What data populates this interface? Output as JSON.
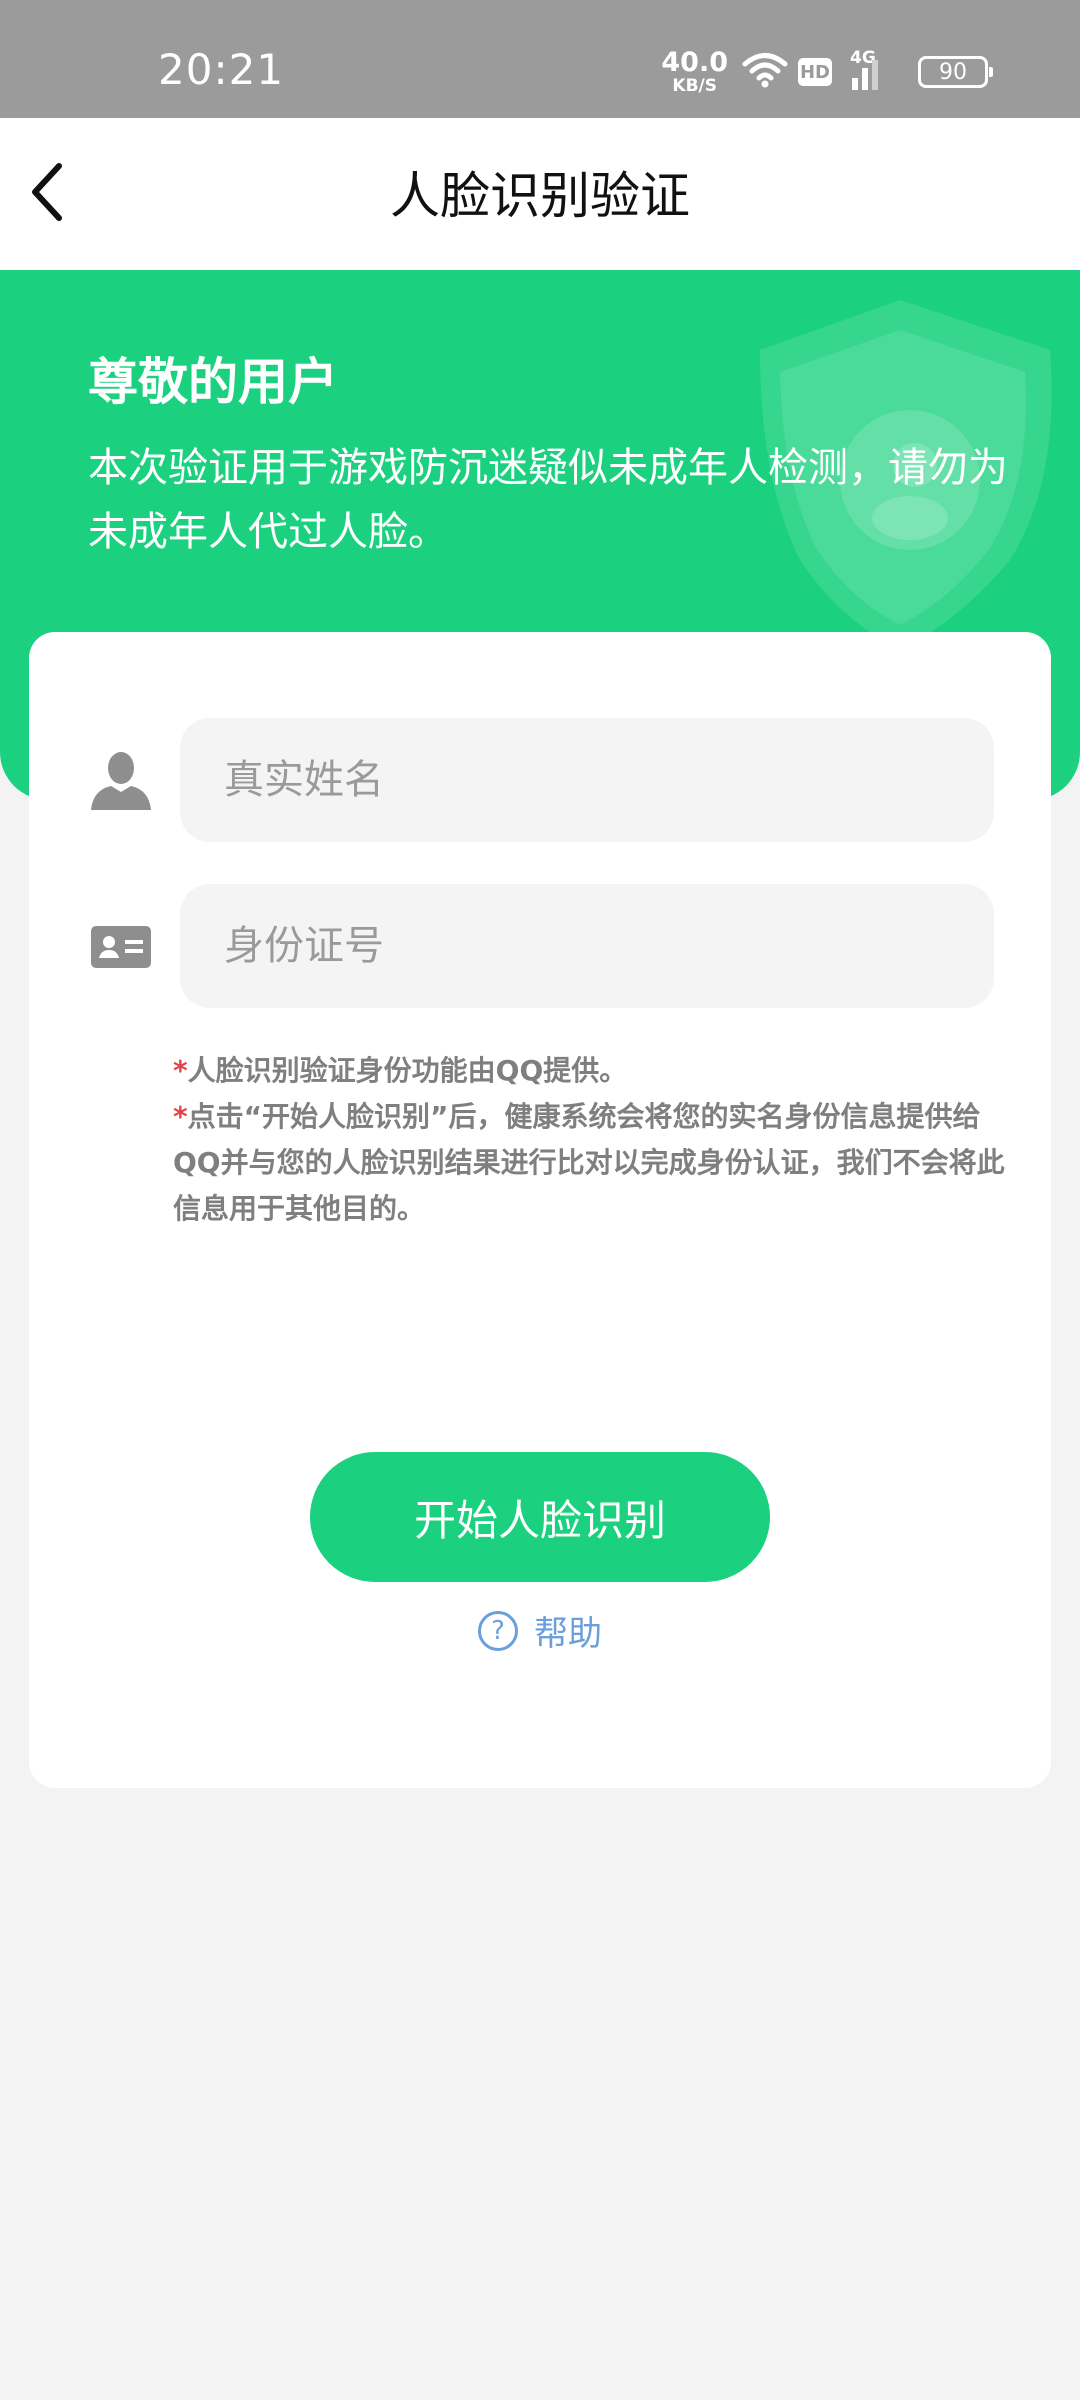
{
  "status_bar": {
    "time": "20:21",
    "net_speed_value": "40.0",
    "net_speed_unit": "KB/S",
    "hd_label": "HD",
    "signal_label": "4G",
    "battery": "90"
  },
  "nav": {
    "title": "人脸识别验证"
  },
  "banner": {
    "greeting": "尊敬的用户",
    "description": "本次验证用于游戏防沉迷疑似未成年人检测，请勿为未成年人代过人脸。"
  },
  "form": {
    "name_placeholder": "真实姓名",
    "id_placeholder": "身份证号"
  },
  "notes": {
    "star": "*",
    "note1": "人脸识别验证身份功能由QQ提供。",
    "note2": "点击“开始人脸识别”后，健康系统会将您的实名身份信息提供给QQ并与您的人脸识别结果进行比对以完成身份认证，我们不会将此信息用于其他目的。"
  },
  "actions": {
    "start_button": "开始人脸识别",
    "help_icon": "?",
    "help_label": "帮助"
  },
  "colors": {
    "accent_green": "#1bd17f",
    "link_blue": "#6a9fd9",
    "note_star_red": "#e24444"
  },
  "icons": {
    "back": "chevron-left-icon",
    "wifi": "wifi-icon",
    "signal": "signal-icon",
    "battery": "battery-icon",
    "shield": "shield-icon",
    "user": "user-icon",
    "id_card": "id-card-icon",
    "help": "question-circle-icon"
  }
}
